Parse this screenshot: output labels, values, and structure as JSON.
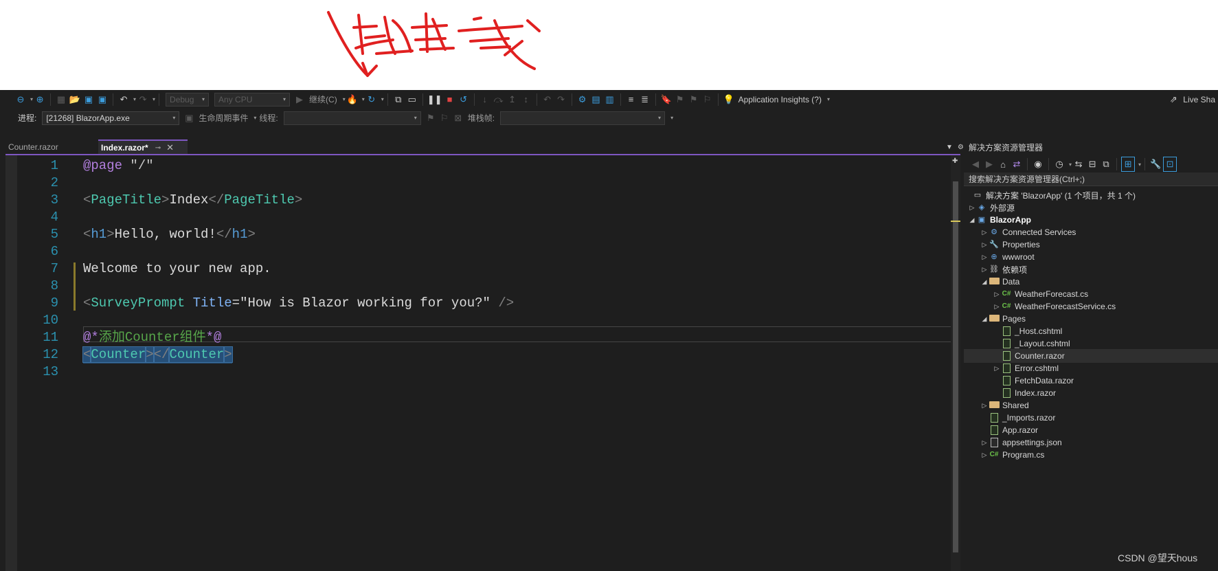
{
  "annotation": {
    "handwriting_color": "#e02020"
  },
  "toolbar": {
    "configuration": "Debug",
    "platform": "Any CPU",
    "continue_label": "继续(C)",
    "app_insights": "Application Insights (?)",
    "live_share": "Live Sha",
    "process_label": "进程:",
    "process_value": "[21268] BlazorApp.exe",
    "lifecycle_label": "生命周期事件",
    "thread_label": "线程:",
    "stack_label": "堆栈帧:"
  },
  "tabs": [
    {
      "label": "Counter.razor"
    },
    {
      "label": "Index.razor*"
    }
  ],
  "editor": {
    "line_numbers": [
      "1",
      "2",
      "3",
      "4",
      "5",
      "6",
      "7",
      "8",
      "9",
      "10",
      "11",
      "12",
      "13"
    ],
    "line1": {
      "kw": "@page",
      "str": " \"/\""
    },
    "line3": {
      "open_lt": "<",
      "tag": "PageTitle",
      "open_gt": ">",
      "text": "Index",
      "close_lt": "</",
      "tag2": "PageTitle",
      "close_gt": ">"
    },
    "line5": {
      "open_lt": "<",
      "tag": "h1",
      "open_gt": ">",
      "text": "Hello, world!",
      "close_lt": "</",
      "tag2": "h1",
      "close_gt": ">"
    },
    "line7": {
      "text": "Welcome to your new app."
    },
    "line9": {
      "open_lt": "<",
      "tag": "SurveyPrompt",
      "attr": " Title",
      "eq": "=",
      "value": "\"How is Blazor working for you?\"",
      "close": " />"
    },
    "line11": {
      "open": "@*",
      "comment": "添加Counter组件",
      "close": "*@"
    },
    "line12": {
      "open_lt": "<",
      "tag": "Counter",
      "open_gt": ">",
      "close_lt": "</",
      "tag2": "Counter",
      "close_gt": ">"
    }
  },
  "solution_explorer": {
    "title": "解决方案资源管理器",
    "search_placeholder": "搜索解决方案资源管理器(Ctrl+;)",
    "items": [
      {
        "label": "解决方案 'BlazorApp' (1 个项目，共 1 个)"
      },
      {
        "label": "外部源"
      },
      {
        "label": "BlazorApp"
      },
      {
        "label": "Connected Services"
      },
      {
        "label": "Properties"
      },
      {
        "label": "wwwroot"
      },
      {
        "label": "依赖项"
      },
      {
        "label": "Data"
      },
      {
        "label": "WeatherForecast.cs"
      },
      {
        "label": "WeatherForecastService.cs"
      },
      {
        "label": "Pages"
      },
      {
        "label": "_Host.cshtml"
      },
      {
        "label": "_Layout.cshtml"
      },
      {
        "label": "Counter.razor"
      },
      {
        "label": "Error.cshtml"
      },
      {
        "label": "FetchData.razor"
      },
      {
        "label": "Index.razor"
      },
      {
        "label": "Shared"
      },
      {
        "label": "_Imports.razor"
      },
      {
        "label": "App.razor"
      },
      {
        "label": "appsettings.json"
      },
      {
        "label": "Program.cs"
      }
    ]
  },
  "watermark": "CSDN @望天hous"
}
